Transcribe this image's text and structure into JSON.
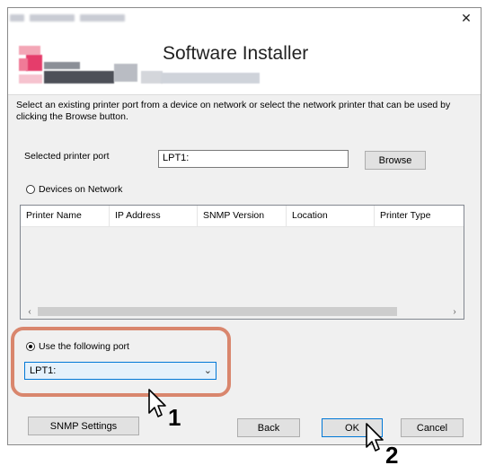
{
  "window": {
    "close_glyph": "✕"
  },
  "banner": {
    "title": "Software Installer"
  },
  "instructions": "Select an existing printer port from a device on network or select the network printer that can be used by clicking the Browse button.",
  "printer_port": {
    "label": "Selected printer port",
    "value": "LPT1:",
    "browse_label": "Browse"
  },
  "devices_radio": {
    "label": "Devices on Network",
    "selected": false
  },
  "device_table": {
    "columns": [
      "Printer Name",
      "IP Address",
      "SNMP Version",
      "Location",
      "Printer Type"
    ],
    "rows": [],
    "scroll_left": "‹",
    "scroll_right": "›"
  },
  "port_radio": {
    "label": "Use the following port",
    "selected": true
  },
  "port_select": {
    "value": "LPT1:",
    "arrow": "⌄"
  },
  "buttons": {
    "snmp": "SNMP Settings",
    "back": "Back",
    "ok": "OK",
    "cancel": "Cancel"
  },
  "step_markers": {
    "step1": "1",
    "step2": "2"
  },
  "colors": {
    "highlight": "#d9866d",
    "focus_blue": "#0078d7",
    "combo_bg": "#e5f1fb"
  }
}
